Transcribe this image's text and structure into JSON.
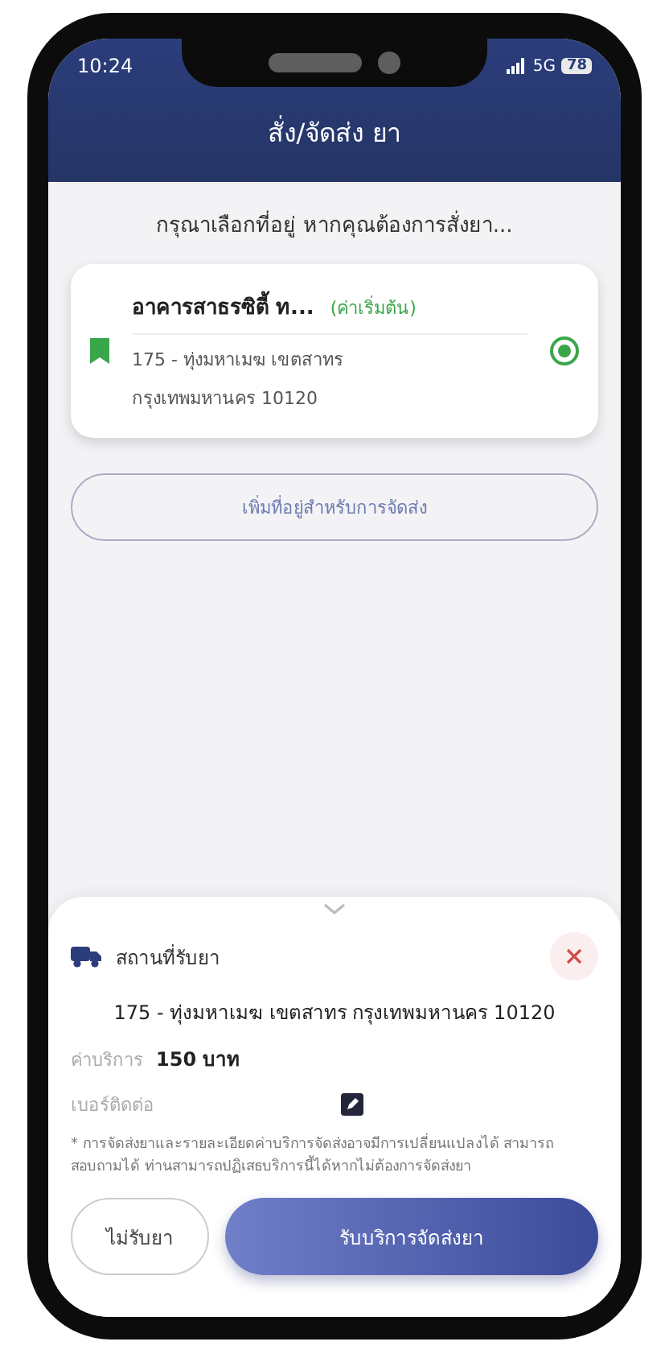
{
  "status_bar": {
    "time": "10:24",
    "network": "5G",
    "battery": "78"
  },
  "header": {
    "title": "สั่ง/จัดส่ง ยา"
  },
  "prompt": "กรุณาเลือกที่อยู่ หากคุณต้องการสั่งยา...",
  "addresses": [
    {
      "name": "อาคารสาธรซิตี้ ท...",
      "tag": "(ค่าเริ่มต้น)",
      "line_1": "175 - ทุ่งมหาเมฆ เขตสาทร",
      "line_2": "กรุงเทพมหานคร 10120",
      "selected": true
    }
  ],
  "add_address_button": "เพิ่มที่อยู่สำหรับการจัดส่ง",
  "sheet": {
    "title": "สถานที่รับยา",
    "address": "175 - ทุ่งมหาเมฆ เขตสาทร กรุงเทพมหานคร 10120",
    "fee_label": "ค่าบริการ",
    "fee_value": "150 บาท",
    "phone_label": "เบอร์ติดต่อ",
    "note": "* การจัดส่งยาและรายละเอียดค่าบริการจัดส่งอาจมีการเปลี่ยนแปลงได้ สามารถสอบถามได้ ท่านสามารถปฏิเสธบริการนี้ได้หากไม่ต้องการจัดส่งยา",
    "buttons": [
      {
        "label": "ไม่รับยา",
        "kind": "outline"
      },
      {
        "label": "รับบริการจัดส่งยา",
        "kind": "primary"
      }
    ]
  }
}
